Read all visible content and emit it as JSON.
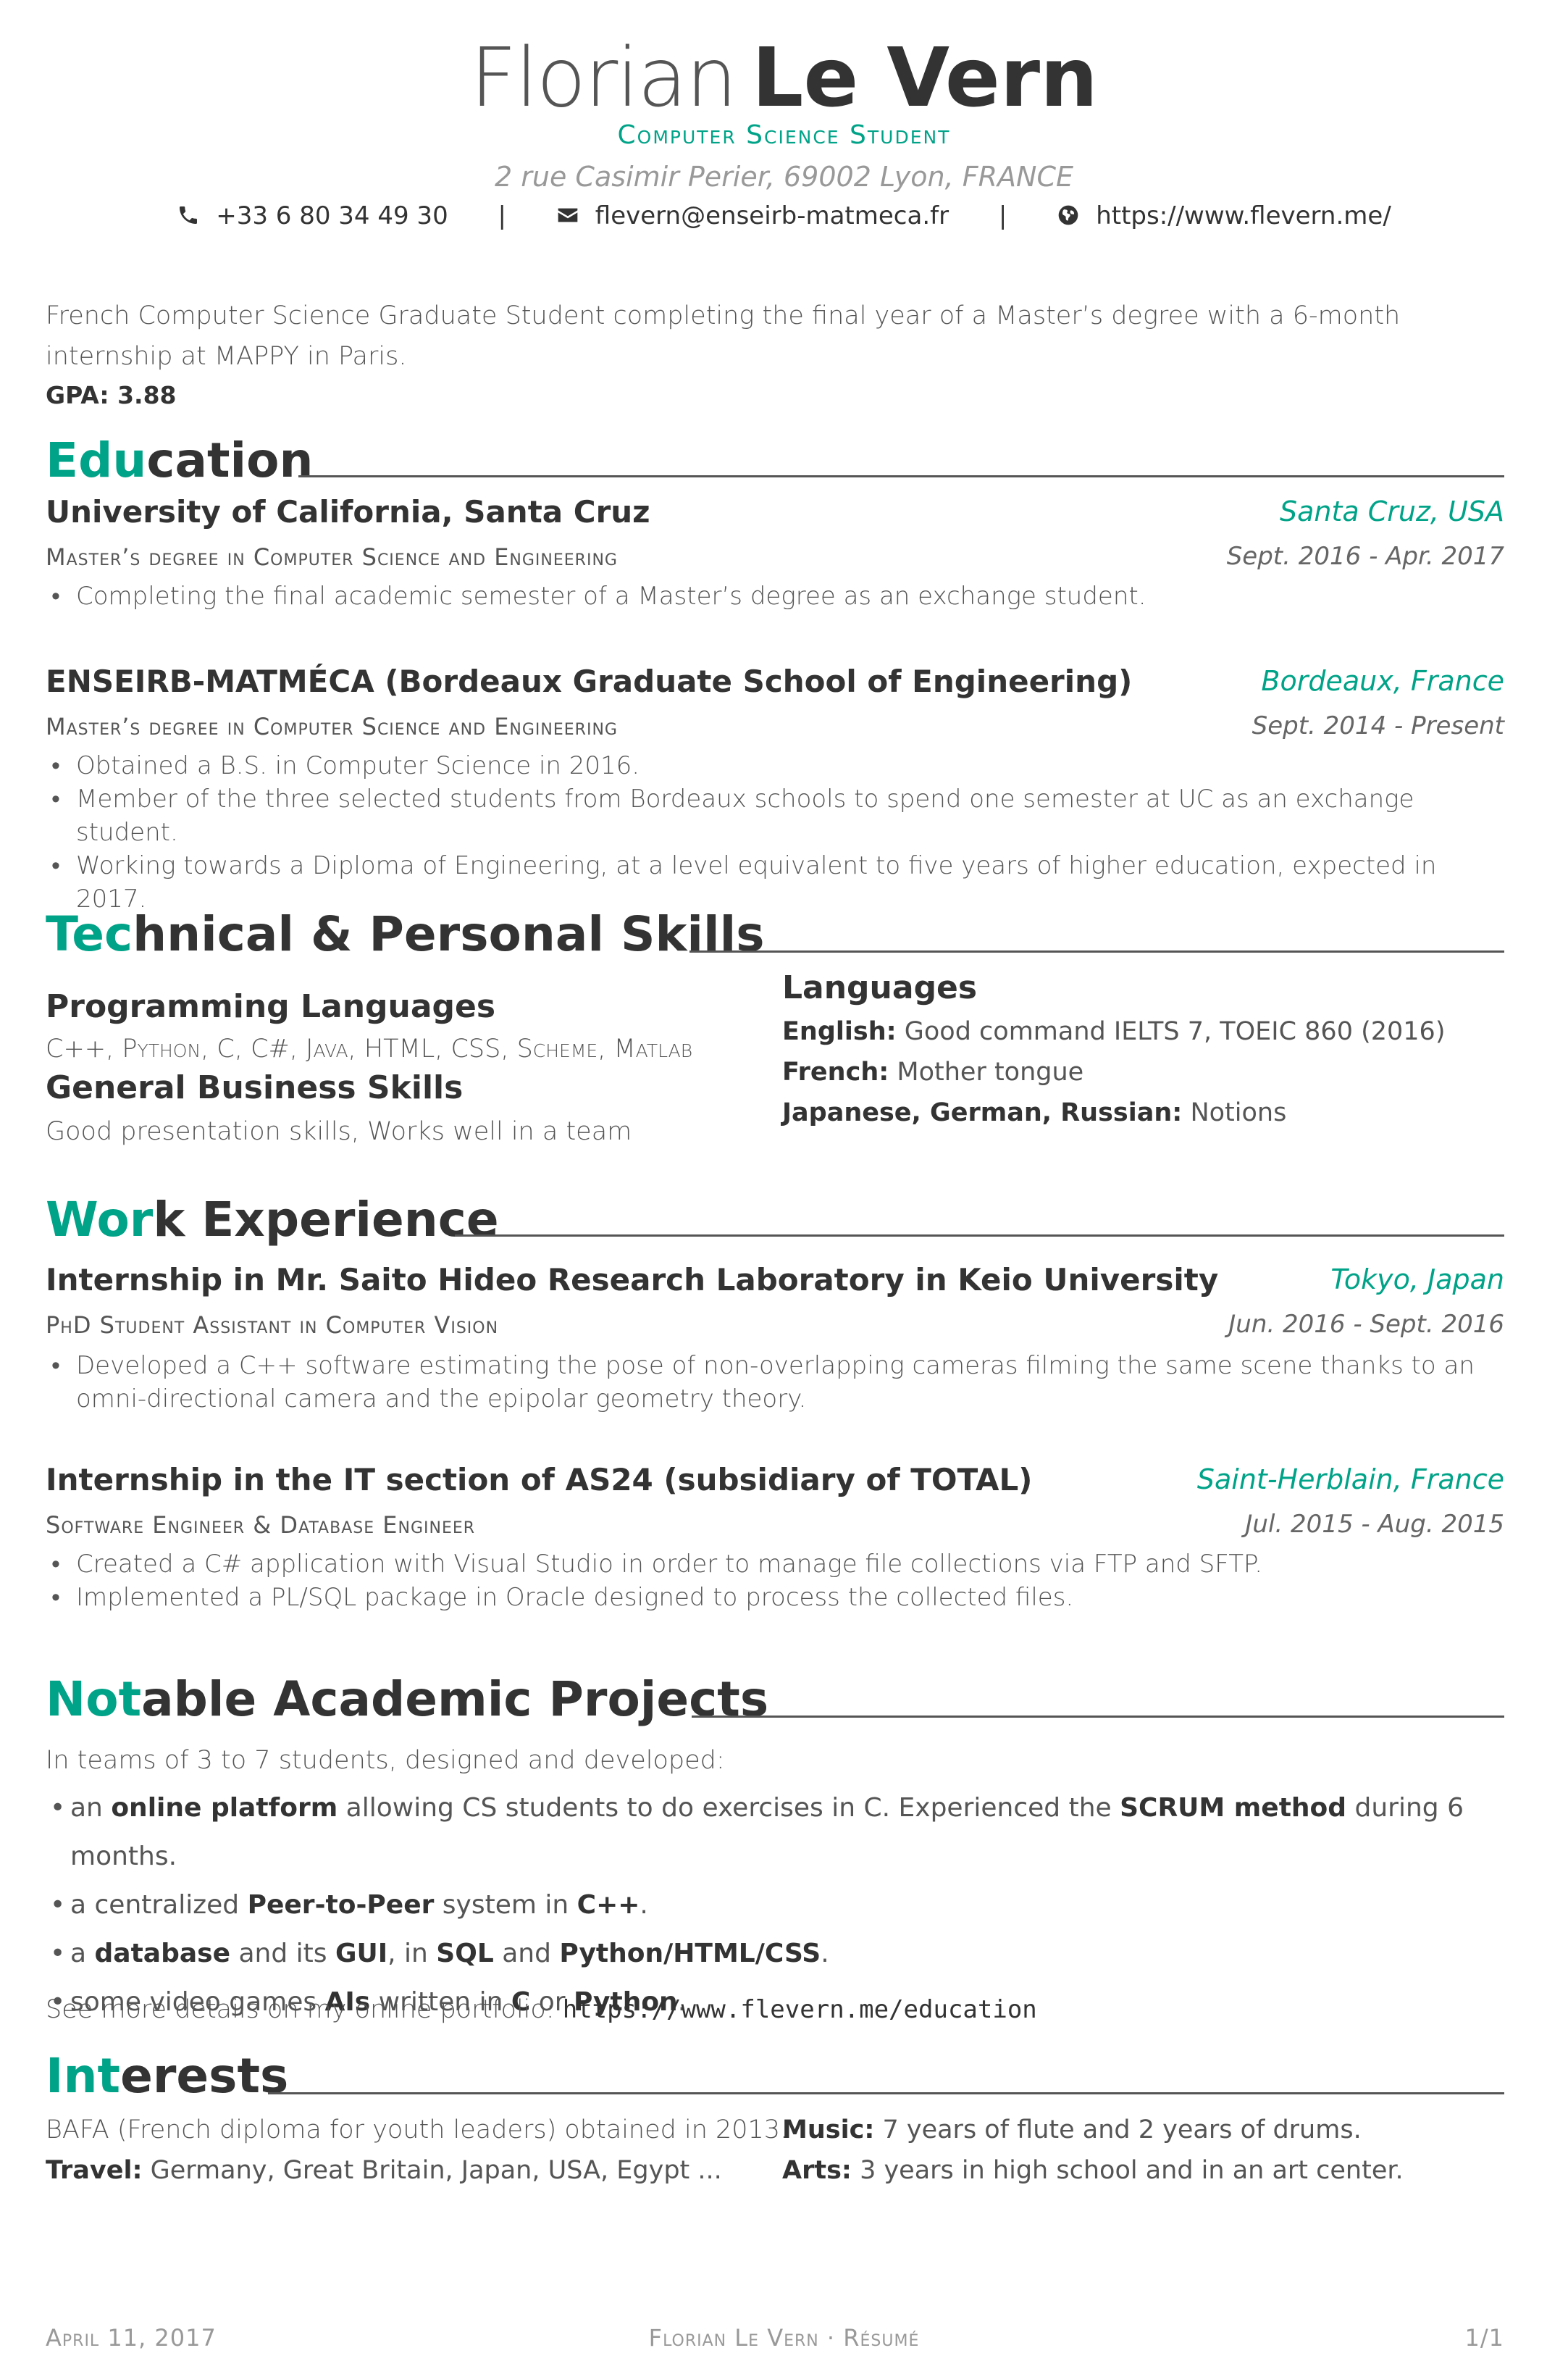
{
  "header": {
    "first_name": "Florian",
    "last_name": "Le Vern",
    "position": "Computer Science Student",
    "address": "2 rue Casimir Perier, 69002 Lyon, FRANCE",
    "phone": "+33 6 80 34 49 30",
    "email": "flevern@enseirb-matmeca.fr",
    "website": "https://www.flevern.me/",
    "separator": "|"
  },
  "summary": {
    "text": "French Computer Science Graduate Student completing the final year of a Master’s degree with a 6-month internship at MAPPY in Paris.",
    "gpa": "GPA: 3.88"
  },
  "education": {
    "title_accent": "Edu",
    "title_rest": "cation",
    "entries": [
      {
        "title": "University of California, Santa Cruz",
        "location": "Santa Cruz, USA",
        "position": "Master’s degree in Computer Science and Engineering",
        "date": "Sept. 2016 - Apr. 2017",
        "bullets": [
          "Completing the final academic semester of a Master’s degree as an exchange student."
        ]
      },
      {
        "title": "ENSEIRB-MATMÉCA (Bordeaux Graduate School of Engineering)",
        "location": "Bordeaux, France",
        "position": "Master’s degree in Computer Science and Engineering",
        "date": "Sept. 2014 - Present",
        "bullets": [
          "Obtained a B.S. in Computer Science in 2016.",
          "Member of the three selected students from Bordeaux schools to spend one semester at UC as an exchange student.",
          "Working towards a Diploma of Engineering, at a level equivalent to five years of higher education, expected in 2017."
        ]
      }
    ]
  },
  "skills": {
    "title_accent": "Tec",
    "title_rest": "hnical & Personal Skills",
    "programming_title": "Programming Languages",
    "programming_text": "C++, Python, C, C#, Java, HTML, CSS, Scheme, Matlab",
    "business_title": "General Business Skills",
    "business_text": "Good presentation skills, Works well in a team",
    "languages_title": "Languages",
    "languages": [
      {
        "label": "English:",
        "value": "Good command IELTS 7, TOEIC 860 (2016)"
      },
      {
        "label": "French:",
        "value": "Mother tongue"
      },
      {
        "label": "Japanese, German, Russian:",
        "value": "Notions"
      }
    ]
  },
  "work": {
    "title_accent": "Wor",
    "title_rest": "k Experience",
    "entries": [
      {
        "title": "Internship in Mr. Saito Hideo Research Laboratory in Keio University",
        "location": "Tokyo, Japan",
        "position": "PhD Student Assistant in Computer Vision",
        "date": "Jun. 2016 - Sept. 2016",
        "bullets": [
          "Developed a C++ software estimating the pose of non-overlapping cameras filming the same scene thanks to an omni-directional camera and the epipolar geometry theory."
        ]
      },
      {
        "title": "Internship in the IT section of AS24 (subsidiary of TOTAL)",
        "location": "Saint-Herblain, France",
        "position": "Software Engineer & Database Engineer",
        "date": "Jul. 2015 - Aug. 2015",
        "bullets": [
          "Created a C# application with Visual Studio in order to manage file collections via FTP and SFTP.",
          "Implemented a PL/SQL package in Oracle designed to process the collected files."
        ]
      }
    ]
  },
  "projects": {
    "title_accent": "Not",
    "title_rest": "able Academic Projects",
    "intro": "In teams of 3 to 7 students, designed and developed:",
    "items": [
      [
        {
          "t": "an "
        },
        {
          "t": "online platform",
          "b": true
        },
        {
          "t": " allowing CS students to do exercises in C. Experienced the "
        },
        {
          "t": "SCRUM method",
          "b": true
        },
        {
          "t": " during 6 months."
        }
      ],
      [
        {
          "t": "a centralized "
        },
        {
          "t": "Peer-to-Peer",
          "b": true
        },
        {
          "t": " system in "
        },
        {
          "t": "C++",
          "b": true
        },
        {
          "t": "."
        }
      ],
      [
        {
          "t": "a "
        },
        {
          "t": "database",
          "b": true
        },
        {
          "t": " and its "
        },
        {
          "t": "GUI",
          "b": true
        },
        {
          "t": ", in "
        },
        {
          "t": "SQL",
          "b": true
        },
        {
          "t": " and "
        },
        {
          "t": "Python/HTML/CSS",
          "b": true
        },
        {
          "t": "."
        }
      ],
      [
        {
          "t": "some video games "
        },
        {
          "t": "AIs",
          "b": true
        },
        {
          "t": " written in "
        },
        {
          "t": "C",
          "b": true
        },
        {
          "t": " or "
        },
        {
          "t": "Python",
          "b": true
        },
        {
          "t": "."
        }
      ]
    ],
    "more_text": "See more details on my online portfolio: ",
    "more_link": "https://www.flevern.me/education"
  },
  "interests": {
    "title_accent": "Int",
    "title_rest": "erests",
    "bafa": "BAFA (French diploma for youth leaders) obtained in 2013.",
    "travel_label": "Travel:",
    "travel_value": "Germany, Great Britain, Japan, USA, Egypt ...",
    "music_label": "Music:",
    "music_value": "7 years of flute and 2 years of drums.",
    "arts_label": "Arts:",
    "arts_value": "3 years in high school and in an art center."
  },
  "footer": {
    "date": "April 11, 2017",
    "center": "Florian Le Vern · Résumé",
    "page": "1/1"
  },
  "colors": {
    "accent": "#00a388",
    "text": "#333333",
    "muted": "#999999"
  }
}
